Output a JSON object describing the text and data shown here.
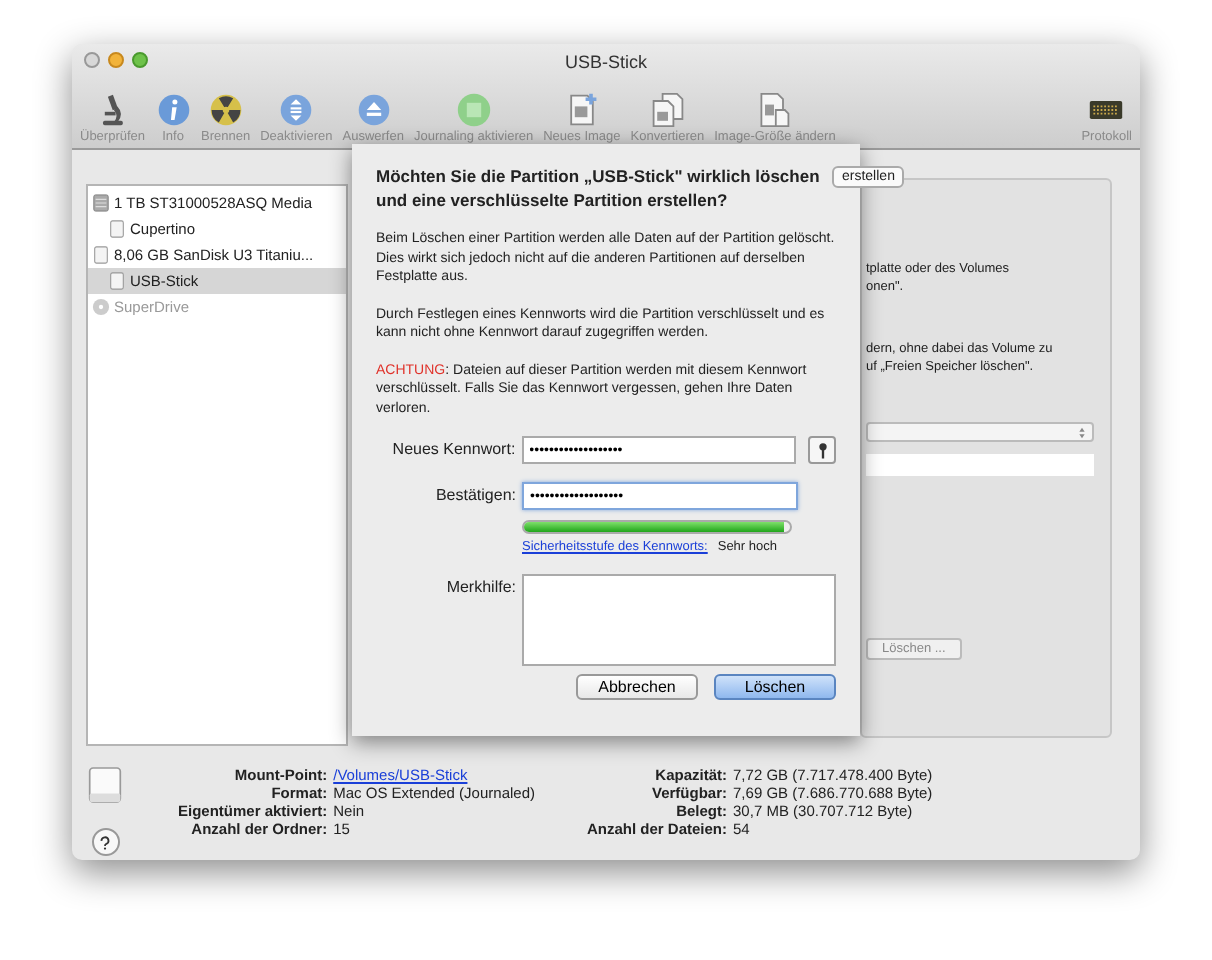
{
  "window": {
    "title": "USB-Stick"
  },
  "toolbar": [
    {
      "label": "Überprüfen",
      "kind": "microscope"
    },
    {
      "label": "Info",
      "kind": "info"
    },
    {
      "label": "Brennen",
      "kind": "burn"
    },
    {
      "label": "Deaktivieren",
      "kind": "unmount"
    },
    {
      "label": "Auswerfen",
      "kind": "eject"
    },
    {
      "label": "Journaling aktivieren",
      "kind": "journal"
    },
    {
      "label": "Neues Image",
      "kind": "newimage"
    },
    {
      "label": "Konvertieren",
      "kind": "convert"
    },
    {
      "label": "Image-Größe ändern",
      "kind": "resize"
    },
    {
      "label": "Protokoll",
      "kind": "log"
    }
  ],
  "sidebar": {
    "items": [
      {
        "label": "1 TB ST31000528ASQ Media",
        "kind": "disk",
        "selected": false,
        "disabled": false,
        "children": [
          {
            "label": "Cupertino",
            "kind": "volume",
            "selected": false,
            "disabled": false
          }
        ]
      },
      {
        "label": "8,06 GB SanDisk U3 Titaniu...",
        "kind": "usb",
        "selected": false,
        "disabled": false,
        "children": [
          {
            "label": "USB-Stick",
            "kind": "volume",
            "selected": true,
            "disabled": false
          }
        ]
      },
      {
        "label": "SuperDrive",
        "kind": "optical",
        "selected": false,
        "disabled": true
      }
    ]
  },
  "background_panel": {
    "tab": "erstellen",
    "texts": [
      "tplatte oder des Volumes",
      "onen\".",
      "dern, ohne dabei das Volume zu",
      "uf „Freien Speicher löschen\"."
    ],
    "button": "Löschen ..."
  },
  "dialog": {
    "title": "Möchten Sie die Partition „USB-Stick\" wirklich löschen und eine verschlüsselte Partition erstellen?",
    "paragraphs": [
      "Beim Löschen einer Partition werden alle Daten auf der Partition gelöscht. Dies wirkt sich jedoch nicht auf die anderen Partitionen auf derselben Festplatte aus.",
      "Durch Festlegen eines Kennworts wird die Partition verschlüsselt und es kann nicht ohne Kennwort darauf zugegriffen werden."
    ],
    "warning": {
      "label": "ACHTUNG",
      "text": ": Dateien auf dieser Partition werden mit diesem Kennwort verschlüsselt. Falls Sie das Kennwort vergessen, gehen Ihre Daten verloren."
    },
    "fields": [
      {
        "label": "Neues Kennwort:",
        "value": "•••••••••••••••••••",
        "focused": false
      },
      {
        "label": "Bestätigen:",
        "value": "•••••••••••••••••••",
        "focused": true
      }
    ],
    "strength": {
      "level": 0.98,
      "link": "Sicherheitsstufe des Kennworts:",
      "reading": "Sehr hoch"
    },
    "hint": {
      "label": "Merkhilfe:"
    },
    "buttons": [
      {
        "label": "Abbrechen",
        "default": false
      },
      {
        "label": "Löschen",
        "default": true
      }
    ]
  },
  "info": {
    "left": [
      {
        "label": "Mount-Point:",
        "value": "/Volumes/USB-Stick",
        "kind": "link"
      },
      {
        "label": "Format:",
        "value": "Mac OS Extended (Journaled)",
        "kind": "text"
      },
      {
        "label": "Eigentümer aktiviert:",
        "value": "Nein",
        "kind": "text"
      },
      {
        "label": "Anzahl der Ordner:",
        "value": "15",
        "kind": "text"
      }
    ],
    "right": [
      {
        "label": "Kapazität:",
        "value": "7,72 GB (7.717.478.400 Byte)"
      },
      {
        "label": "Verfügbar:",
        "value": "7,69 GB (7.686.770.688 Byte)"
      },
      {
        "label": "Belegt:",
        "value": "30,7 MB (30.707.712 Byte)"
      },
      {
        "label": "Anzahl der Dateien:",
        "value": "54"
      }
    ]
  }
}
